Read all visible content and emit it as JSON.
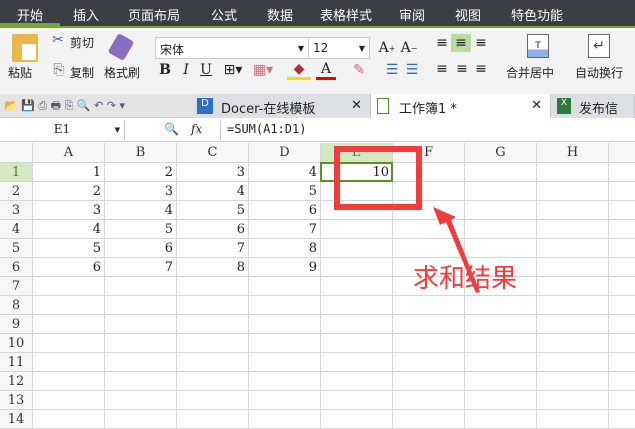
{
  "menu": [
    "开始",
    "插入",
    "页面布局",
    "公式",
    "数据",
    "表格样式",
    "审阅",
    "视图",
    "特色功能"
  ],
  "ribbon": {
    "paste": "粘贴",
    "cut": "剪切",
    "copy": "复制",
    "format_painter": "格式刷",
    "font": "宋体",
    "size": "12",
    "bold": "B",
    "italic": "I",
    "underline": "U",
    "merge": "合并居中",
    "wrap": "自动换行"
  },
  "tabs": [
    {
      "label": "Docer-在线模板"
    },
    {
      "label": "工作簿1 *"
    },
    {
      "label": "发布信息.x"
    }
  ],
  "formula": {
    "cell_ref": "E1",
    "fx": "fx",
    "value": "=SUM(A1:D1)"
  },
  "columns": [
    "A",
    "B",
    "C",
    "D",
    "E",
    "F",
    "G",
    "H"
  ],
  "rows": [
    [
      "1",
      "2",
      "3",
      "4",
      "10"
    ],
    [
      "2",
      "3",
      "4",
      "5",
      ""
    ],
    [
      "3",
      "4",
      "5",
      "6",
      ""
    ],
    [
      "4",
      "5",
      "6",
      "7",
      ""
    ],
    [
      "5",
      "6",
      "7",
      "8",
      ""
    ],
    [
      "6",
      "7",
      "8",
      "9",
      ""
    ]
  ],
  "row_count": 14,
  "annotation": "求和结果",
  "colors": {
    "accent": "#6fa833",
    "annotation": "#f03c3c"
  }
}
